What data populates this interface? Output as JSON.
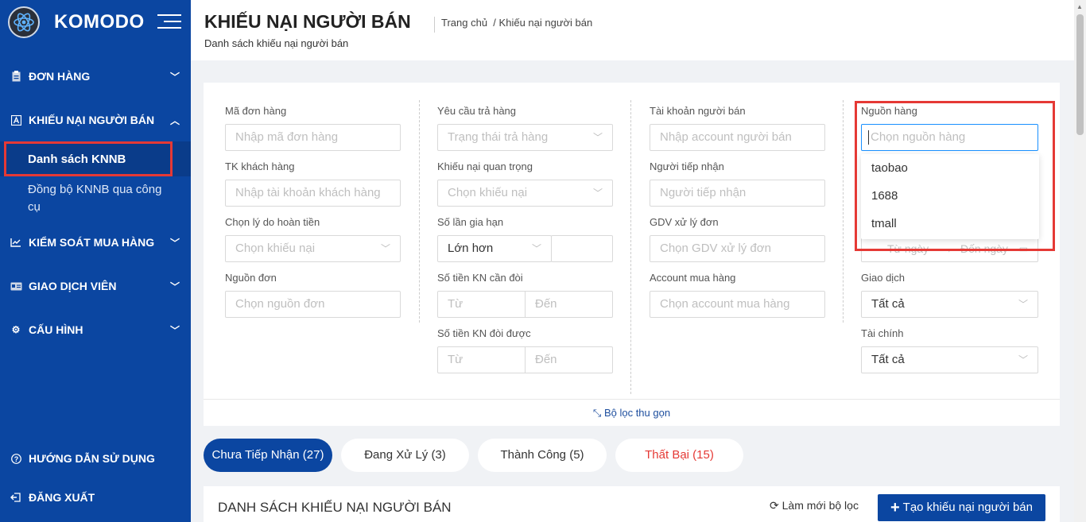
{
  "brand": {
    "name": "KOMODO"
  },
  "sidebar": {
    "items": [
      {
        "label": "ĐƠN HÀNG",
        "icon": "clipboard-icon"
      },
      {
        "label": "KHIẾU NẠI NGƯỜI BÁN",
        "icon": "letter-a-icon"
      },
      {
        "label": "KIỂM SOÁT MUA HÀNG",
        "icon": "chart-icon"
      },
      {
        "label": "GIAO DỊCH VIÊN",
        "icon": "card-icon"
      },
      {
        "label": "CẤU HÌNH",
        "icon": "gear-icon"
      }
    ],
    "sub_items": [
      "Danh sách KNNB",
      "Đồng bộ KNNB qua công cụ"
    ],
    "bottom": [
      {
        "label": "HƯỚNG DẪN SỬ DỤNG",
        "icon": "help-icon"
      },
      {
        "label": "ĐĂNG XUẤT",
        "icon": "logout-icon"
      }
    ]
  },
  "header": {
    "title": "KHIẾU NẠI NGƯỜI BÁN",
    "subtitle": "Danh sách khiếu nại người bán",
    "breadcrumb_home": "Trang chủ",
    "breadcrumb_sep": "/",
    "breadcrumb_current": "Khiếu nại người bán"
  },
  "filters": {
    "order_code": {
      "label": "Mã đơn hàng",
      "placeholder": "Nhập mã đơn hàng"
    },
    "customer": {
      "label": "TK khách hàng",
      "placeholder": "Nhập tài khoản khách hàng"
    },
    "refund_reason": {
      "label": "Chọn lý do hoàn tiền",
      "placeholder": "Chọn khiếu nại"
    },
    "order_source": {
      "label": "Nguồn đơn",
      "placeholder": "Chọn nguồn đơn"
    },
    "return_request": {
      "label": "Yêu cầu trả hàng",
      "placeholder": "Trạng thái trả hàng"
    },
    "important": {
      "label": "Khiếu nại quan trọng",
      "placeholder": "Chọn khiếu nại"
    },
    "extend_count": {
      "label": "Số lần gia hạn",
      "value": "Lớn hơn"
    },
    "claim_amount": {
      "label": "Số tiền KN cần đòi",
      "from": "Từ",
      "to": "Đến"
    },
    "claimed_amount": {
      "label": "Số tiền KN đòi được",
      "from": "Từ",
      "to": "Đến"
    },
    "seller_account": {
      "label": "Tài khoản người bán",
      "placeholder": "Nhập account người bán"
    },
    "receiver": {
      "label": "Người tiếp nhận",
      "placeholder": "Người tiếp nhận"
    },
    "gdv": {
      "label": "GDV xử lý đơn",
      "placeholder": "Chọn GDV xử lý đơn"
    },
    "purchase_account": {
      "label": "Account mua hàng",
      "placeholder": "Chọn account mua hàng"
    },
    "goods_source": {
      "label": "Nguồn hàng",
      "placeholder": "Chọn nguồn hàng",
      "options": [
        "taobao",
        "1688",
        "tmall"
      ]
    },
    "date_range": {
      "from": "Từ ngày",
      "to": "Đến ngày"
    },
    "transaction": {
      "label": "Giao dịch",
      "value": "Tất cả"
    },
    "finance": {
      "label": "Tài chính",
      "value": "Tất cả"
    },
    "collapse_label": "Bộ lọc thu gọn"
  },
  "tabs": [
    {
      "label": "Chưa Tiếp Nhận (27)"
    },
    {
      "label": "Đang Xử Lý (3)"
    },
    {
      "label": "Thành Công (5)"
    },
    {
      "label": "Thất Bại (15)"
    }
  ],
  "list": {
    "title": "DANH SÁCH KHIẾU NẠI NGƯỜI BÁN",
    "refresh_label": "Làm mới bộ lọc",
    "create_label": "Tạo khiếu nại người bán"
  },
  "colors": {
    "primary": "#0b46a1",
    "highlight": "#e53935",
    "danger": "#e53935"
  }
}
